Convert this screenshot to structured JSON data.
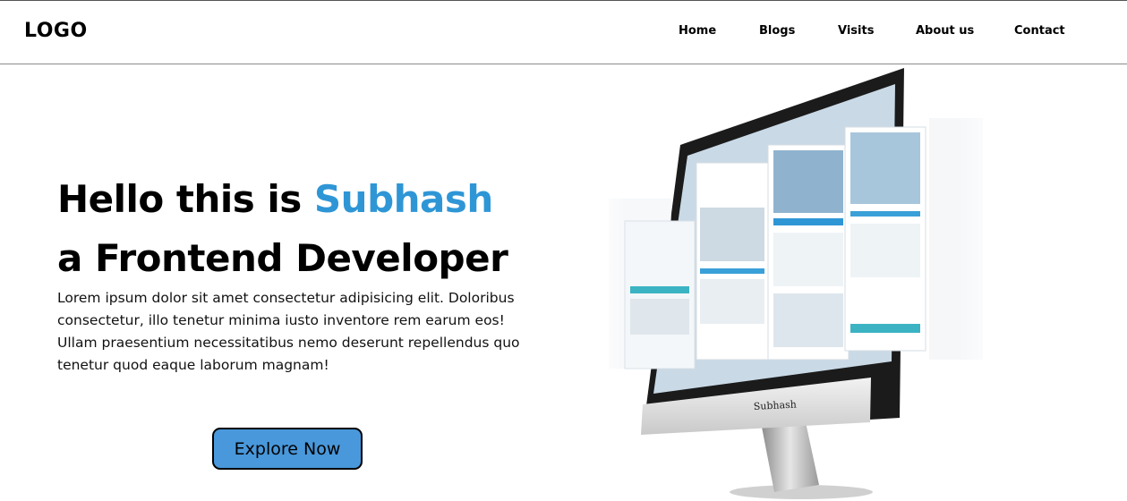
{
  "header": {
    "logo": "LOGO",
    "nav": [
      "Home",
      "Blogs",
      "Visits",
      "About us",
      "Contact"
    ]
  },
  "hero": {
    "headline_prefix": "Hello this is ",
    "name": "Subhash",
    "headline_line2": "a Frontend Developer",
    "description": "Lorem ipsum dolor sit amet consectetur adipisicing elit. Doloribus consectetur, illo tenetur minima iusto inventore rem earum eos! Ullam praesentium necessitatibus nemo deserunt repellendus quo tenetur quod eaque laborum magnam!",
    "cta_label": "Explore Now",
    "monitor_brand": "Subhash"
  },
  "colors": {
    "accent": "#2f96d6",
    "button": "#4998db"
  }
}
